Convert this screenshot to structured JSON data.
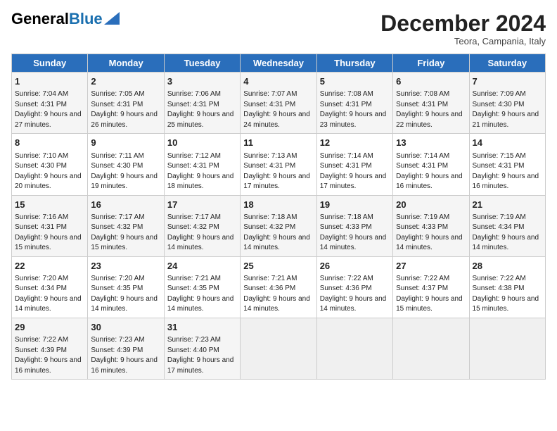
{
  "header": {
    "logo_general": "General",
    "logo_blue": "Blue",
    "month_title": "December 2024",
    "subtitle": "Teora, Campania, Italy"
  },
  "days_of_week": [
    "Sunday",
    "Monday",
    "Tuesday",
    "Wednesday",
    "Thursday",
    "Friday",
    "Saturday"
  ],
  "weeks": [
    [
      {
        "day": "1",
        "sunrise": "7:04 AM",
        "sunset": "4:31 PM",
        "daylight": "9 hours and 27 minutes."
      },
      {
        "day": "2",
        "sunrise": "7:05 AM",
        "sunset": "4:31 PM",
        "daylight": "9 hours and 26 minutes."
      },
      {
        "day": "3",
        "sunrise": "7:06 AM",
        "sunset": "4:31 PM",
        "daylight": "9 hours and 25 minutes."
      },
      {
        "day": "4",
        "sunrise": "7:07 AM",
        "sunset": "4:31 PM",
        "daylight": "9 hours and 24 minutes."
      },
      {
        "day": "5",
        "sunrise": "7:08 AM",
        "sunset": "4:31 PM",
        "daylight": "9 hours and 23 minutes."
      },
      {
        "day": "6",
        "sunrise": "7:08 AM",
        "sunset": "4:31 PM",
        "daylight": "9 hours and 22 minutes."
      },
      {
        "day": "7",
        "sunrise": "7:09 AM",
        "sunset": "4:30 PM",
        "daylight": "9 hours and 21 minutes."
      }
    ],
    [
      {
        "day": "8",
        "sunrise": "7:10 AM",
        "sunset": "4:30 PM",
        "daylight": "9 hours and 20 minutes."
      },
      {
        "day": "9",
        "sunrise": "7:11 AM",
        "sunset": "4:30 PM",
        "daylight": "9 hours and 19 minutes."
      },
      {
        "day": "10",
        "sunrise": "7:12 AM",
        "sunset": "4:31 PM",
        "daylight": "9 hours and 18 minutes."
      },
      {
        "day": "11",
        "sunrise": "7:13 AM",
        "sunset": "4:31 PM",
        "daylight": "9 hours and 17 minutes."
      },
      {
        "day": "12",
        "sunrise": "7:14 AM",
        "sunset": "4:31 PM",
        "daylight": "9 hours and 17 minutes."
      },
      {
        "day": "13",
        "sunrise": "7:14 AM",
        "sunset": "4:31 PM",
        "daylight": "9 hours and 16 minutes."
      },
      {
        "day": "14",
        "sunrise": "7:15 AM",
        "sunset": "4:31 PM",
        "daylight": "9 hours and 16 minutes."
      }
    ],
    [
      {
        "day": "15",
        "sunrise": "7:16 AM",
        "sunset": "4:31 PM",
        "daylight": "9 hours and 15 minutes."
      },
      {
        "day": "16",
        "sunrise": "7:17 AM",
        "sunset": "4:32 PM",
        "daylight": "9 hours and 15 minutes."
      },
      {
        "day": "17",
        "sunrise": "7:17 AM",
        "sunset": "4:32 PM",
        "daylight": "9 hours and 14 minutes."
      },
      {
        "day": "18",
        "sunrise": "7:18 AM",
        "sunset": "4:32 PM",
        "daylight": "9 hours and 14 minutes."
      },
      {
        "day": "19",
        "sunrise": "7:18 AM",
        "sunset": "4:33 PM",
        "daylight": "9 hours and 14 minutes."
      },
      {
        "day": "20",
        "sunrise": "7:19 AM",
        "sunset": "4:33 PM",
        "daylight": "9 hours and 14 minutes."
      },
      {
        "day": "21",
        "sunrise": "7:19 AM",
        "sunset": "4:34 PM",
        "daylight": "9 hours and 14 minutes."
      }
    ],
    [
      {
        "day": "22",
        "sunrise": "7:20 AM",
        "sunset": "4:34 PM",
        "daylight": "9 hours and 14 minutes."
      },
      {
        "day": "23",
        "sunrise": "7:20 AM",
        "sunset": "4:35 PM",
        "daylight": "9 hours and 14 minutes."
      },
      {
        "day": "24",
        "sunrise": "7:21 AM",
        "sunset": "4:35 PM",
        "daylight": "9 hours and 14 minutes."
      },
      {
        "day": "25",
        "sunrise": "7:21 AM",
        "sunset": "4:36 PM",
        "daylight": "9 hours and 14 minutes."
      },
      {
        "day": "26",
        "sunrise": "7:22 AM",
        "sunset": "4:36 PM",
        "daylight": "9 hours and 14 minutes."
      },
      {
        "day": "27",
        "sunrise": "7:22 AM",
        "sunset": "4:37 PM",
        "daylight": "9 hours and 15 minutes."
      },
      {
        "day": "28",
        "sunrise": "7:22 AM",
        "sunset": "4:38 PM",
        "daylight": "9 hours and 15 minutes."
      }
    ],
    [
      {
        "day": "29",
        "sunrise": "7:22 AM",
        "sunset": "4:39 PM",
        "daylight": "9 hours and 16 minutes."
      },
      {
        "day": "30",
        "sunrise": "7:23 AM",
        "sunset": "4:39 PM",
        "daylight": "9 hours and 16 minutes."
      },
      {
        "day": "31",
        "sunrise": "7:23 AM",
        "sunset": "4:40 PM",
        "daylight": "9 hours and 17 minutes."
      },
      null,
      null,
      null,
      null
    ]
  ],
  "labels": {
    "sunrise": "Sunrise:",
    "sunset": "Sunset:",
    "daylight": "Daylight:"
  }
}
